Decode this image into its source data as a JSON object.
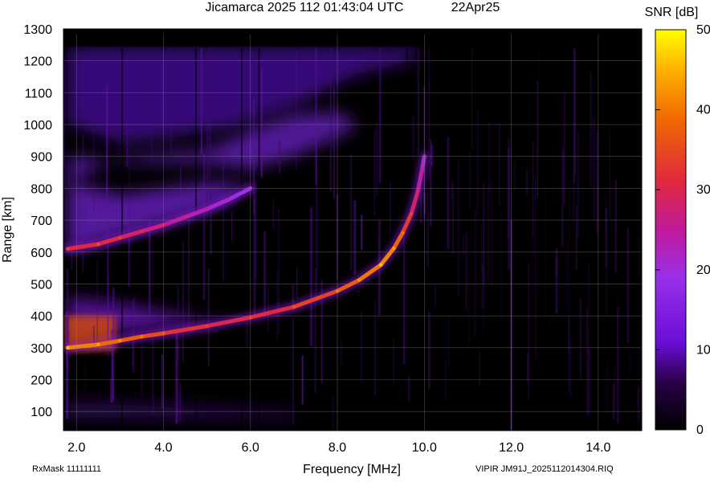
{
  "header": {
    "title": "Jicamarca 2025 112 01:43:04 UTC",
    "date": "22Apr25"
  },
  "footer": {
    "rxmask": "RxMask 11111111",
    "file": "VIPIR  JM91J_2025112014304.RIQ"
  },
  "chart_data": {
    "type": "heatmap",
    "title": "Jicamarca 2025 112 01:43:04 UTC",
    "xlabel": "Frequency [MHz]",
    "ylabel": "Range [km]",
    "xlim": [
      1.7,
      15.0
    ],
    "ylim": [
      40,
      1300
    ],
    "x_ticks": [
      2.0,
      4.0,
      6.0,
      8.0,
      10.0,
      12.0,
      14.0
    ],
    "x_tick_labels": [
      "2.0",
      "4.0",
      "6.0",
      "8.0",
      "10.0",
      "12.0",
      "14.0"
    ],
    "y_ticks": [
      100,
      200,
      300,
      400,
      500,
      600,
      700,
      800,
      900,
      1000,
      1100,
      1200,
      1300
    ],
    "y_tick_labels": [
      "100",
      "200",
      "300",
      "400",
      "500",
      "600",
      "700",
      "800",
      "900",
      "1000",
      "1100",
      "1200",
      "1300"
    ],
    "grid": true,
    "colorbar": {
      "label": "SNR [dB]",
      "range": [
        0,
        50
      ],
      "ticks": [
        0,
        10,
        20,
        30,
        40,
        50
      ],
      "tick_labels": [
        "0",
        "10",
        "20",
        "30",
        "40",
        "50"
      ]
    },
    "series": [
      {
        "name": "",
        "x": [
          1.8,
          2.5,
          3.0,
          3.5,
          4.0,
          5.0,
          6.0,
          7.0,
          8.0,
          8.5,
          9.0,
          9.3,
          9.5,
          9.7,
          9.85,
          9.95,
          10.0
        ],
        "y": [
          300,
          310,
          322,
          335,
          345,
          368,
          395,
          428,
          478,
          512,
          560,
          612,
          660,
          720,
          790,
          860,
          900
        ],
        "snr": [
          42,
          40,
          38,
          36,
          34,
          30,
          30,
          32,
          36,
          38,
          42,
          40,
          36,
          30,
          26,
          22,
          20
        ]
      },
      {
        "name": "",
        "x": [
          1.8,
          2.5,
          3.0,
          3.5,
          4.0,
          4.5,
          5.0,
          5.5,
          6.0
        ],
        "y": [
          610,
          625,
          645,
          665,
          685,
          710,
          735,
          765,
          800
        ],
        "snr": [
          30,
          32,
          30,
          28,
          26,
          24,
          22,
          20,
          18
        ]
      }
    ]
  }
}
